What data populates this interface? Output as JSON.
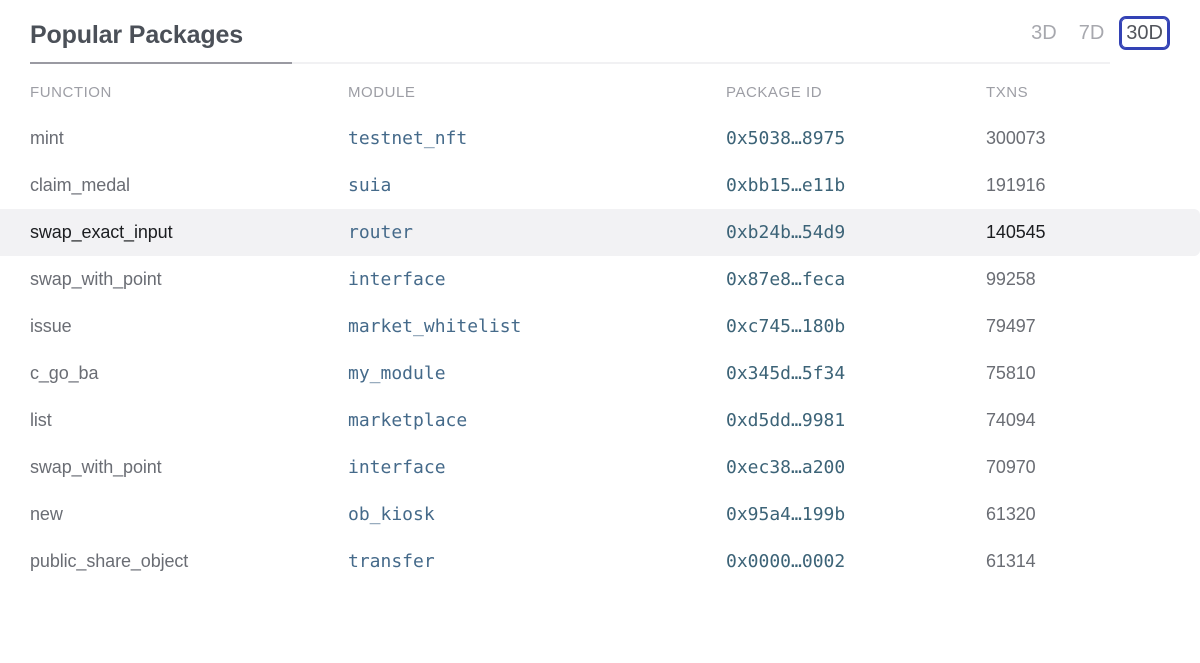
{
  "header": {
    "title": "Popular Packages",
    "ranges": [
      {
        "label": "3D",
        "state": "inactive"
      },
      {
        "label": "7D",
        "state": "inactive"
      },
      {
        "label": "30D",
        "state": "focused"
      }
    ]
  },
  "table": {
    "columns": [
      "FUNCTION",
      "MODULE",
      "PACKAGE ID",
      "TXNS"
    ],
    "rows": [
      {
        "function": "mint",
        "module": "testnet_nft",
        "package_id": "0x5038…8975",
        "txns": "300073",
        "highlighted": false
      },
      {
        "function": "claim_medal",
        "module": "suia",
        "package_id": "0xbb15…e11b",
        "txns": "191916",
        "highlighted": false
      },
      {
        "function": "swap_exact_input",
        "module": "router",
        "package_id": "0xb24b…54d9",
        "txns": "140545",
        "highlighted": true
      },
      {
        "function": "swap_with_point",
        "module": "interface",
        "package_id": "0x87e8…feca",
        "txns": "99258",
        "highlighted": false
      },
      {
        "function": "issue",
        "module": "market_whitelist",
        "package_id": "0xc745…180b",
        "txns": "79497",
        "highlighted": false
      },
      {
        "function": "c_go_ba",
        "module": "my_module",
        "package_id": "0x345d…5f34",
        "txns": "75810",
        "highlighted": false
      },
      {
        "function": "list",
        "module": "marketplace",
        "package_id": "0xd5dd…9981",
        "txns": "74094",
        "highlighted": false
      },
      {
        "function": "swap_with_point",
        "module": "interface",
        "package_id": "0xec38…a200",
        "txns": "70970",
        "highlighted": false
      },
      {
        "function": "new",
        "module": "ob_kiosk",
        "package_id": "0x95a4…199b",
        "txns": "61320",
        "highlighted": false
      },
      {
        "function": "public_share_object",
        "module": "transfer",
        "package_id": "0x0000…0002",
        "txns": "61314",
        "highlighted": false
      }
    ]
  },
  "colors": {
    "focus_ring": "#3342b5",
    "module_text": "#456a8a",
    "package_text": "#3c6377",
    "muted_text": "#9d9ea5",
    "row_highlight_bg": "#f2f2f4"
  }
}
